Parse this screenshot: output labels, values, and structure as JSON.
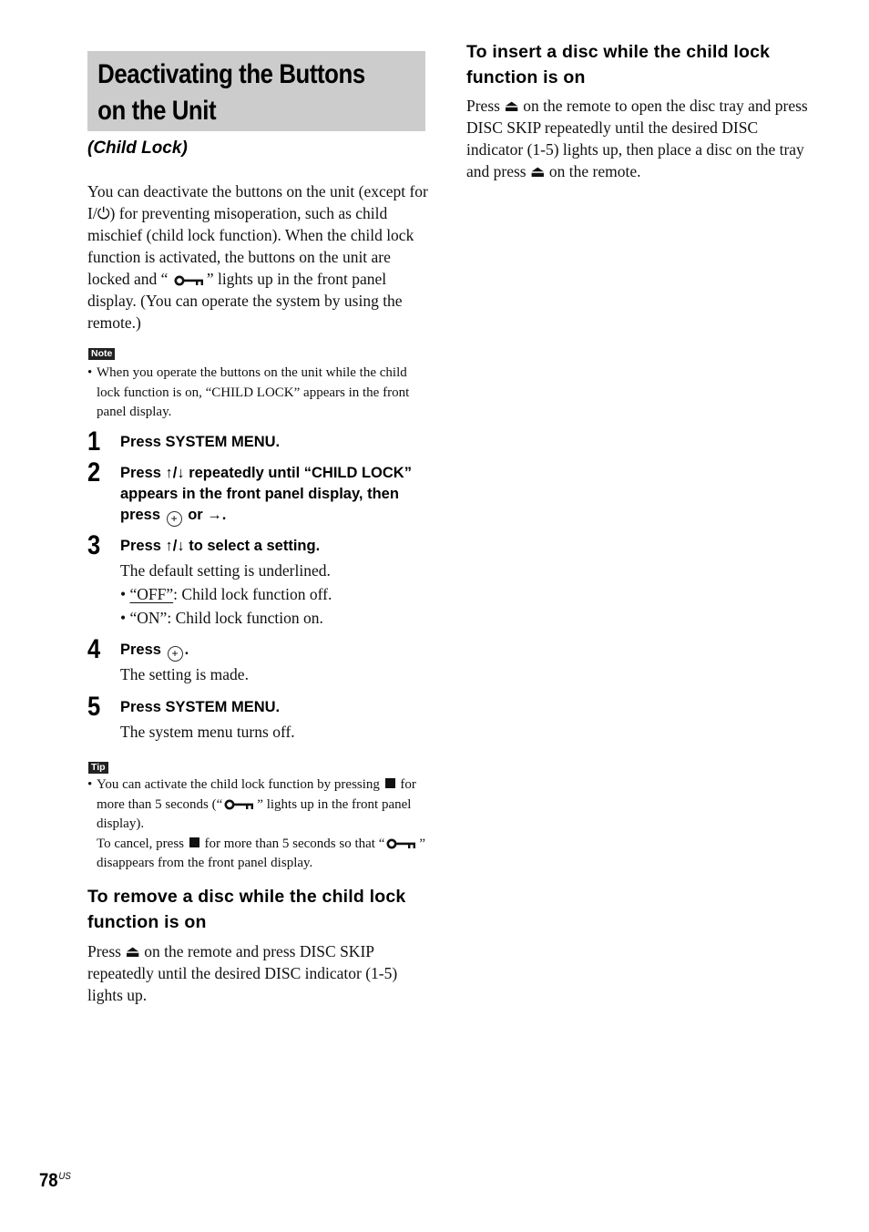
{
  "page": {
    "title": "Deactivating the Buttons on the Unit",
    "title_line1": "Deactivating the Buttons",
    "title_line2": "on the Unit",
    "subtitle": "(Child Lock)",
    "page_number": "78",
    "page_region": "US"
  },
  "intro": {
    "part1": "You can deactivate the buttons on the unit (except for ",
    "power_symbol": "I/⏻",
    "part2": ") for preventing misoperation, such as child mischief (child lock function). When the child lock function is activated, the buttons on the unit are locked and “",
    "part3": "” lights up in the front panel display. (You can operate the system by using the remote.)"
  },
  "note": {
    "label": "Note",
    "bullet": "•",
    "text": "When you operate the buttons on the unit while the child lock function is on, “CHILD LOCK” appears in the front panel display."
  },
  "steps": [
    {
      "number": "1",
      "heading": "Press SYSTEM MENU."
    },
    {
      "number": "2",
      "heading_a": "Press ↑/↓ repeatedly until “CHILD LOCK” appears in the front panel display, then press",
      "heading_b": "or →."
    },
    {
      "number": "3",
      "heading": "Press ↑/↓ to select a setting.",
      "desc": "The default setting is underlined.",
      "options": [
        {
          "bullet": "•",
          "value": "“OFF”",
          "text": ": Child lock function off.",
          "default": true
        },
        {
          "bullet": "•",
          "value": "“ON”",
          "text": ": Child lock function on.",
          "default": false
        }
      ]
    },
    {
      "number": "4",
      "heading_a": "Press",
      "heading_b": ".",
      "desc": "The setting is made."
    },
    {
      "number": "5",
      "heading": "Press SYSTEM MENU.",
      "desc": "The system menu turns off."
    }
  ],
  "tip": {
    "label": "Tip",
    "bullet": "•",
    "line1": "You can activate the child lock function by pressing",
    "part_a": "for more than 5 seconds (“",
    "part_b": "” lights up in the front panel display).",
    "cancel_a": "To cancel, press",
    "cancel_b": "for more than 5 seconds so that “",
    "cancel_c": "” disappears from the front panel display."
  },
  "remove_disc": {
    "heading": "To remove a disc while the child lock function is on",
    "press": "Press ",
    "eject_symbol": "⏏",
    "text": " on the remote and press DISC SKIP repeatedly until the desired DISC indicator (1-5) lights up."
  },
  "insert_disc": {
    "heading": "To insert a disc while the child lock function is on",
    "press": "Press ",
    "eject_symbol": "⏏",
    "text_a": " on the remote to open the disc tray and press DISC SKIP repeatedly until the desired DISC indicator (1-5) lights up, then place a disc on the tray and press ",
    "text_b": " on the remote."
  },
  "icons": {
    "enter": "+",
    "key": "key-icon",
    "stop": "stop-icon",
    "eject": "eject-icon"
  }
}
